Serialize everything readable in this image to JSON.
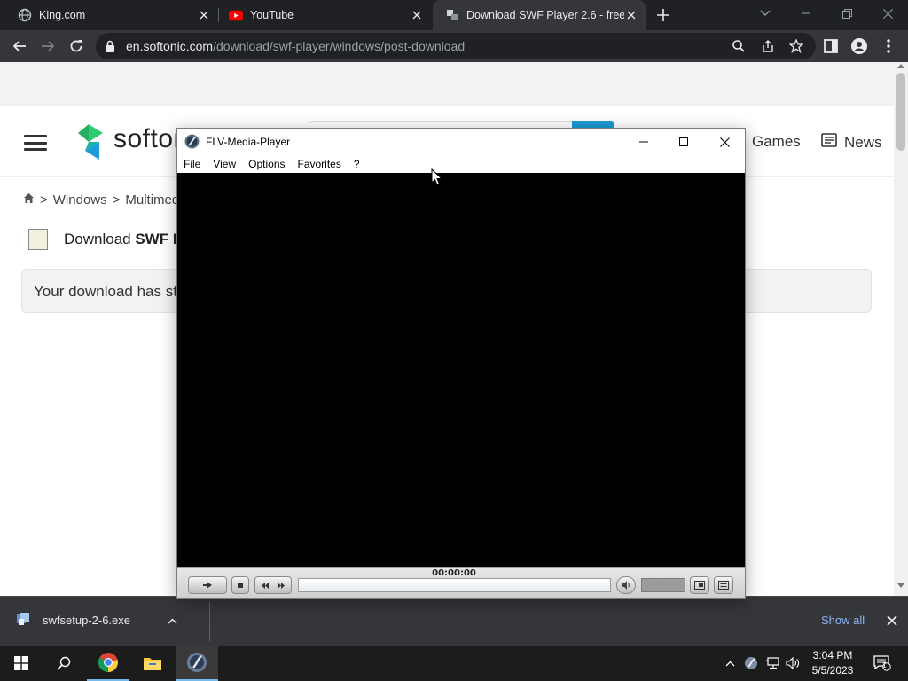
{
  "browser": {
    "tabs": [
      {
        "title": "King.com",
        "active": false
      },
      {
        "title": "YouTube",
        "active": false
      },
      {
        "title": "Download SWF Player 2.6 - free",
        "active": true
      }
    ],
    "url_host": "en.softonic.com",
    "url_path": "/download/swf-player/windows/post-download"
  },
  "page": {
    "logo_text": "softonic",
    "nav_games": "Games",
    "nav_news": "News",
    "breadcrumb": [
      "Windows",
      ">",
      "Multimedi"
    ],
    "breadcrumb_sep": ">",
    "download_title_prefix": "Download ",
    "download_title_bold": "SWF P",
    "notice_text": "Your download has st"
  },
  "flv_window": {
    "title": "FLV-Media-Player",
    "menu": [
      "File",
      "View",
      "Options",
      "Favorites",
      "?"
    ],
    "timecode": "00:00:00"
  },
  "download_shelf": {
    "filename": "swfsetup-2-6.exe",
    "show_all": "Show all"
  },
  "taskbar": {
    "time": "3:04 PM",
    "date": "5/5/2023",
    "notification_count": "1"
  },
  "colors": {
    "tabstrip": "#202124",
    "toolbar": "#35363a",
    "accent_blue": "#1c9bd6",
    "link_blue": "#8ab4f8"
  }
}
